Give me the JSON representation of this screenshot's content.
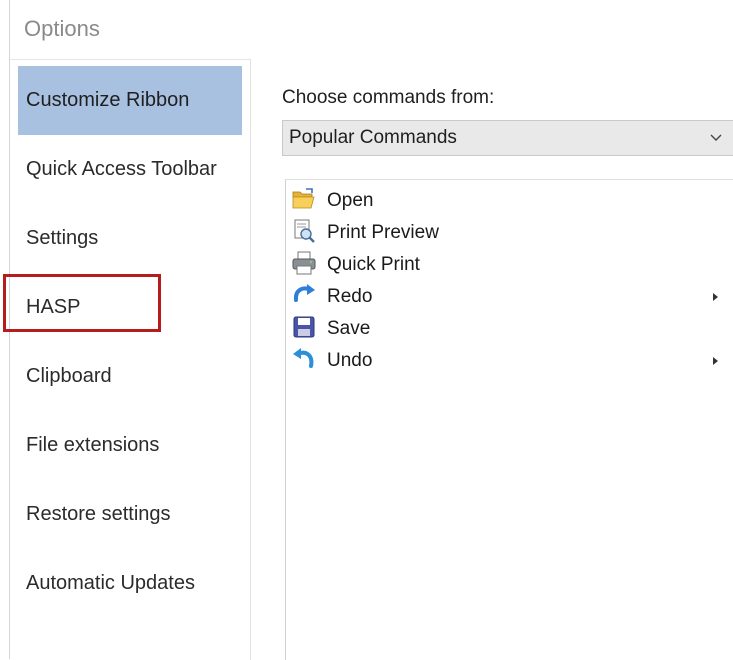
{
  "window": {
    "title": "Options"
  },
  "sidebar": {
    "items": [
      {
        "label": "Customize Ribbon",
        "selected": true
      },
      {
        "label": "Quick Access Toolbar"
      },
      {
        "label": "Settings"
      },
      {
        "label": "HASP"
      },
      {
        "label": "Clipboard"
      },
      {
        "label": "File extensions"
      },
      {
        "label": "Restore settings"
      },
      {
        "label": "Automatic Updates"
      }
    ]
  },
  "main": {
    "choose_label": "Choose commands from:",
    "dropdown": {
      "value": "Popular Commands",
      "chevron": "chevron-down-icon"
    },
    "commands": [
      {
        "label": "Open",
        "icon": "folder-open-icon",
        "submenu": false
      },
      {
        "label": "Print Preview",
        "icon": "print-preview-icon",
        "submenu": false
      },
      {
        "label": "Quick Print",
        "icon": "printer-icon",
        "submenu": false
      },
      {
        "label": "Redo",
        "icon": "redo-icon",
        "submenu": true
      },
      {
        "label": "Save",
        "icon": "save-icon",
        "submenu": false
      },
      {
        "label": "Undo",
        "icon": "undo-icon",
        "submenu": true
      }
    ]
  },
  "colors": {
    "selected_bg": "#a9c1e1",
    "highlight_border": "#b51c1c",
    "dropdown_bg": "#e9e9e9"
  }
}
